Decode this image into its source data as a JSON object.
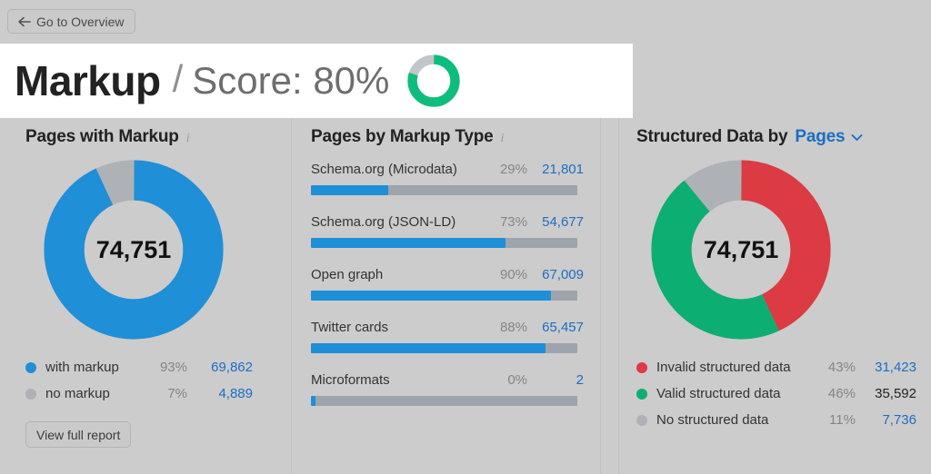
{
  "topbar": {
    "back_button_label": "Go to Overview"
  },
  "header": {
    "title": "Markup",
    "separator": "/",
    "score_label": "Score: 80%",
    "score_percent": 80,
    "score_color": "#0dbd7e",
    "score_track_color": "#c2c6cb"
  },
  "panels": {
    "left": {
      "title": "Pages with Markup",
      "info_icon": "info-icon",
      "donut_center_value": "74,751",
      "legend": [
        {
          "label": "with markup",
          "percent": "93%",
          "value": "69,862",
          "color": "#1f8fd8",
          "value_style": "link"
        },
        {
          "label": "no markup",
          "percent": "7%",
          "value": "4,889",
          "color": "#aeb2b6",
          "value_style": "link"
        }
      ],
      "button_label": "View full report"
    },
    "middle": {
      "title": "Pages by Markup Type",
      "info_icon": "info-icon",
      "bars": [
        {
          "name": "Schema.org (Microdata)",
          "percent": "29%",
          "value": "21,801",
          "fill": 29
        },
        {
          "name": "Schema.org (JSON-LD)",
          "percent": "73%",
          "value": "54,677",
          "fill": 73
        },
        {
          "name": "Open graph",
          "percent": "90%",
          "value": "67,009",
          "fill": 90
        },
        {
          "name": "Twitter cards",
          "percent": "88%",
          "value": "65,457",
          "fill": 88
        },
        {
          "name": "Microformats",
          "percent": "0%",
          "value": "2",
          "fill": 1.6
        }
      ]
    },
    "right": {
      "title_prefix": "Structured Data by",
      "dropdown_value": "Pages",
      "dropdown_icon": "chevron-down-icon",
      "donut_center_value": "74,751",
      "legend": [
        {
          "label": "Invalid structured data",
          "percent": "43%",
          "value": "31,423",
          "color": "#dc3b43",
          "value_style": "link"
        },
        {
          "label": "Valid structured data",
          "percent": "46%",
          "value": "35,592",
          "color": "#0dae72",
          "value_style": "plain"
        },
        {
          "label": "No structured data",
          "percent": "11%",
          "value": "7,736",
          "color": "#aeb2b6",
          "value_style": "link"
        }
      ]
    }
  },
  "chart_data": [
    {
      "type": "pie",
      "title": "Score: 80%",
      "categories": [
        "score",
        "remaining"
      ],
      "values": [
        80,
        20
      ],
      "colors": [
        "#0dbd7e",
        "#c2c6cb"
      ]
    },
    {
      "type": "pie",
      "title": "Pages with Markup",
      "center_label": "74,751",
      "categories": [
        "with markup",
        "no markup"
      ],
      "values": [
        69862,
        4889
      ],
      "percents": [
        93,
        7
      ],
      "colors": [
        "#1f8fd8",
        "#aeb2b6"
      ],
      "legend_position": "bottom"
    },
    {
      "type": "bar",
      "title": "Pages by Markup Type",
      "orientation": "horizontal",
      "categories": [
        "Schema.org (Microdata)",
        "Schema.org (JSON-LD)",
        "Open graph",
        "Twitter cards",
        "Microformats"
      ],
      "values": [
        21801,
        54677,
        67009,
        65457,
        2
      ],
      "percents": [
        29,
        73,
        90,
        88,
        0
      ],
      "xlabel": "",
      "ylabel": "",
      "xlim": [
        0,
        100
      ],
      "grid": false,
      "colors": [
        "#1f8fd8"
      ],
      "track_color": "#9ea4ab"
    },
    {
      "type": "pie",
      "title": "Structured Data by Pages",
      "center_label": "74,751",
      "categories": [
        "Invalid structured data",
        "Valid structured data",
        "No structured data"
      ],
      "values": [
        31423,
        35592,
        7736
      ],
      "percents": [
        43,
        46,
        11
      ],
      "colors": [
        "#dc3b43",
        "#0dae72",
        "#aeb2b6"
      ],
      "legend_position": "bottom"
    }
  ]
}
